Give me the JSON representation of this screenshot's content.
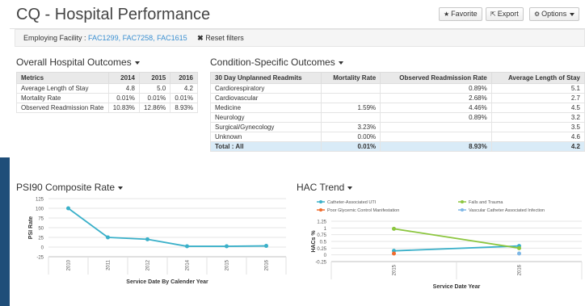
{
  "header": {
    "title": "CQ - Hospital Performance",
    "buttons": {
      "favorite": "Favorite",
      "export": "Export",
      "options": "Options"
    }
  },
  "filter": {
    "label": "Employing Facility :",
    "value": "FAC1299, FAC7258, FAC1615",
    "reset": "Reset filters"
  },
  "overall": {
    "title": "Overall Hospital Outcomes",
    "headers": [
      "Metrics",
      "2014",
      "2015",
      "2016"
    ],
    "rows": [
      [
        "Average Length of Stay",
        "4.8",
        "5.0",
        "4.2"
      ],
      [
        "Mortality Rate",
        "0.01%",
        "0.01%",
        "0.01%"
      ],
      [
        "Observed Readmission Rate",
        "10.83%",
        "12.86%",
        "8.93%"
      ]
    ]
  },
  "condition": {
    "title": "Condition-Specific Outcomes",
    "headers": [
      "30 Day Unplanned Readmits",
      "Mortality Rate",
      "Observed Readmission Rate",
      "Average Length of Stay"
    ],
    "rows": [
      [
        "Cardiorespiratory",
        "",
        "0.89%",
        "5.1"
      ],
      [
        "Cardiovascular",
        "",
        "2.68%",
        "2.7"
      ],
      [
        "Medicine",
        "1.59%",
        "4.46%",
        "4.5"
      ],
      [
        "Neurology",
        "",
        "0.89%",
        "3.2"
      ],
      [
        "Surgical/Gynecology",
        "3.23%",
        "",
        "3.5"
      ],
      [
        "Unknown",
        "0.00%",
        "",
        "4.6"
      ]
    ],
    "total": [
      "Total : All",
      "0.01%",
      "8.93%",
      "4.2"
    ]
  },
  "chart_data": [
    {
      "type": "line",
      "title": "PSI90 Composite Rate",
      "xlabel": "Service Date By Calender Year",
      "ylabel": "PSI Rate",
      "categories": [
        "2010",
        "2011",
        "2012",
        "2014",
        "2015",
        "2016"
      ],
      "ylim": [
        -25,
        125
      ],
      "yticks": [
        -25,
        0,
        25,
        50,
        75,
        100,
        125
      ],
      "series": [
        {
          "color": "#3ab0c9",
          "values": [
            100,
            25,
            20,
            2,
            2,
            3
          ]
        }
      ]
    },
    {
      "type": "line",
      "title": "HAC Trend",
      "xlabel": "Service Date Year",
      "ylabel": "HACs %",
      "categories": [
        "2015",
        "2016"
      ],
      "ylim": [
        -0.25,
        1.25
      ],
      "yticks": [
        -0.25,
        0,
        0.25,
        0.5,
        0.75,
        1,
        1.25
      ],
      "series": [
        {
          "name": "Catheter-Associated UTI",
          "color": "#3ab0c9",
          "values": [
            0.15,
            0.33
          ]
        },
        {
          "name": "Falls and Trauma",
          "color": "#8cc63f",
          "values": [
            0.97,
            0.25
          ]
        },
        {
          "name": "Poor Glycemic Control Manifestation",
          "color": "#f06c2e",
          "values": [
            0.05,
            null
          ]
        },
        {
          "name": "Vascular Catheter Associated Infection",
          "color": "#7fb7e6",
          "values": [
            null,
            0.05
          ]
        }
      ]
    }
  ]
}
